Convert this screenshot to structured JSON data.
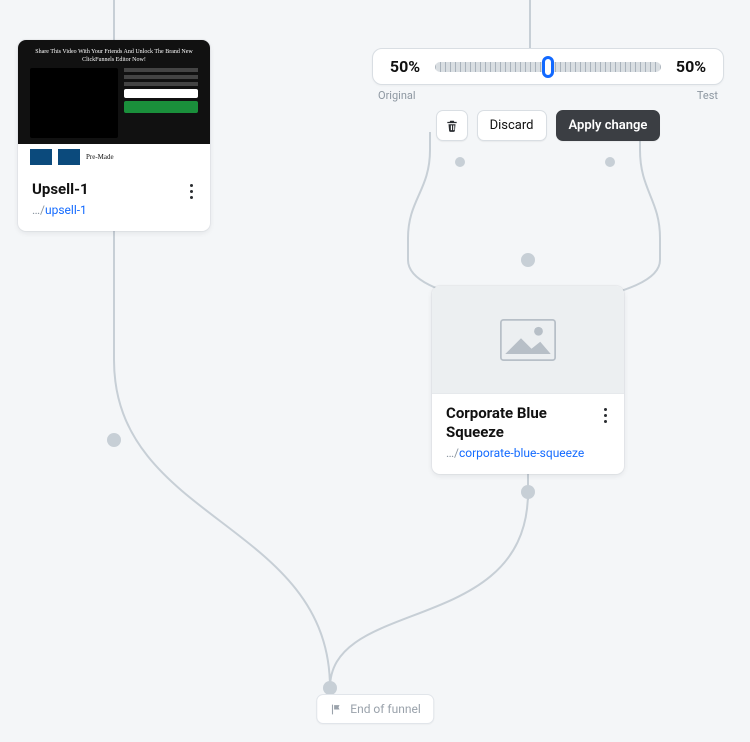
{
  "split_test": {
    "original_pct": "50%",
    "test_pct": "50%",
    "original_label": "Original",
    "test_label": "Test",
    "discard_label": "Discard",
    "apply_label": "Apply change"
  },
  "upsell_card": {
    "title": "Upsell-1",
    "path_prefix": "…/",
    "path_slug": "upsell-1",
    "preview_headline": "Share This Video With Your Friends And Unlock The Brand New ClickFunnels Editor Now!",
    "preview_footer_label": "Pre-Made"
  },
  "cbs_card": {
    "title": "Corporate Blue Squeeze",
    "path_prefix": "…/",
    "path_slug": "corporate-blue-squeeze"
  },
  "end_of_funnel_label": "End of funnel"
}
